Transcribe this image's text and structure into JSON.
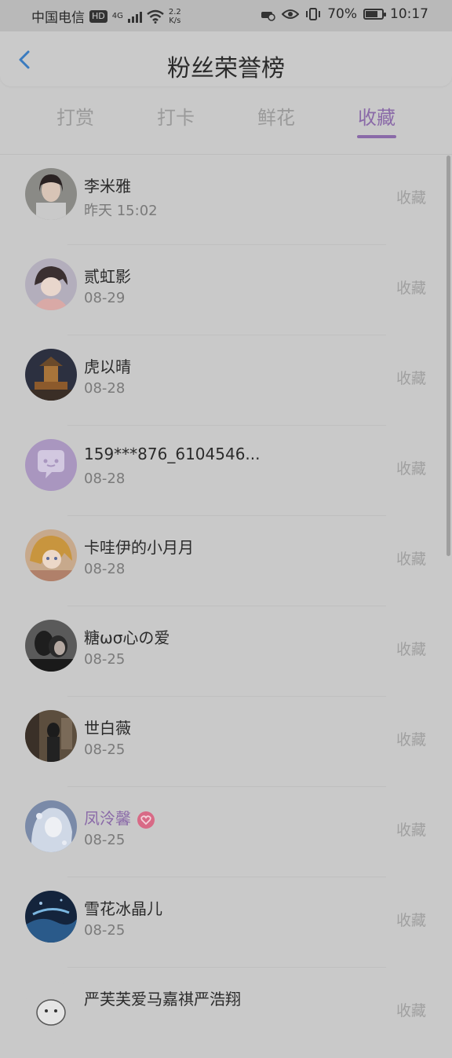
{
  "status": {
    "carrier": "中国电信",
    "hd": "HD",
    "network": "4G",
    "speed_top": "2.2",
    "speed_bottom": "K/s",
    "battery": "70%",
    "time": "10:17"
  },
  "header": {
    "title": "粉丝荣誉榜"
  },
  "tabs": [
    {
      "label": "打赏",
      "active": false
    },
    {
      "label": "打卡",
      "active": false
    },
    {
      "label": "鲜花",
      "active": false
    },
    {
      "label": "收藏",
      "active": true
    }
  ],
  "fans": [
    {
      "name": "李米雅",
      "time": "昨天 15:02",
      "action": "收藏"
    },
    {
      "name": "贰虹影",
      "time": "08-29",
      "action": "收藏"
    },
    {
      "name": "虎以晴",
      "time": "08-28",
      "action": "收藏"
    },
    {
      "name": "159***876_6104546...",
      "time": "08-28",
      "action": "收藏"
    },
    {
      "name": "卡哇伊的小月月",
      "time": "08-28",
      "action": "收藏"
    },
    {
      "name": "糖ωσ心の爱",
      "time": "08-25",
      "action": "收藏"
    },
    {
      "name": "世白薇",
      "time": "08-25",
      "action": "收藏"
    },
    {
      "name": "凤泠馨",
      "time": "08-25",
      "action": "收藏"
    },
    {
      "name": "雪花冰晶儿",
      "time": "08-25",
      "action": "收藏"
    },
    {
      "name": "严芙芙爱马嘉祺严浩翔",
      "time": "",
      "action": "收藏"
    }
  ],
  "colors": {
    "accent": "#8a6aa8",
    "vip_badge": "#d86a86",
    "back_arrow": "#3a7bbf"
  }
}
